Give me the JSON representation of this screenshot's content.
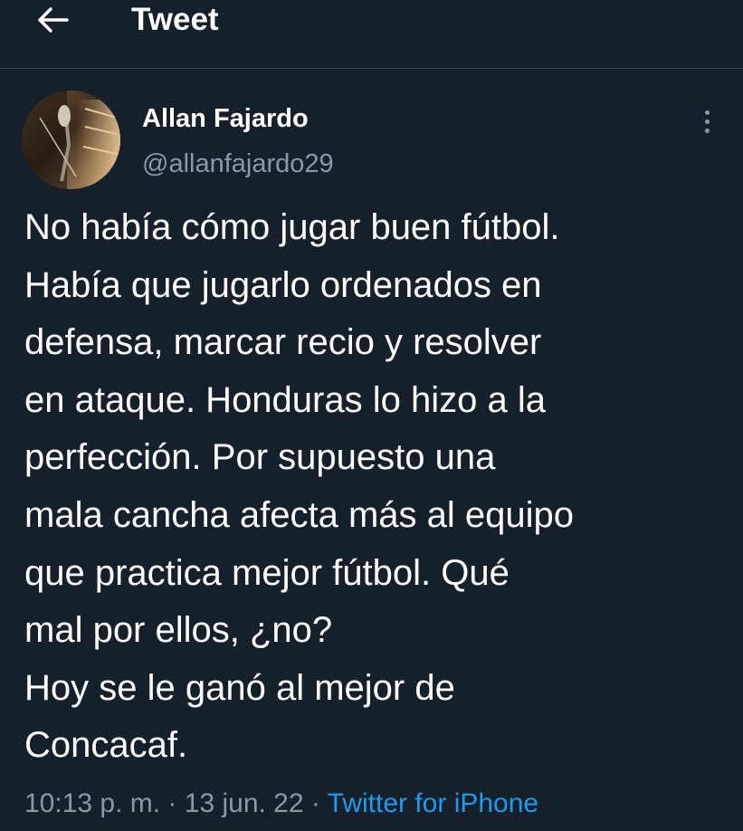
{
  "header": {
    "back_icon": "arrow-left-icon",
    "title": "Tweet"
  },
  "author": {
    "name": "Allan Fajardo",
    "handle": "@allanfajardo29",
    "avatar_icon": "microphone-photo-avatar"
  },
  "menu": {
    "icon": "more-vertical-icon"
  },
  "tweet": {
    "lines": [
      "No había cómo jugar buen fútbol.",
      "Había que jugarlo ordenados en",
      "defensa, marcar recio y resolver",
      "en ataque. Honduras lo hizo a la",
      "perfección. Por supuesto una",
      "mala cancha afecta más al equipo",
      "que practica mejor fútbol. Qué",
      "mal por ellos, ¿no?",
      "Hoy se le ganó al mejor de",
      "Concacaf."
    ]
  },
  "meta": {
    "time": "10:13 p. m.",
    "sep1": " · ",
    "date": "13 jun. 22",
    "sep2": " · ",
    "source": "Twitter for iPhone"
  },
  "colors": {
    "background": "#15202b",
    "secondary_text": "#8b98a5",
    "link": "#1d9bf0",
    "divider": "#38444d"
  }
}
